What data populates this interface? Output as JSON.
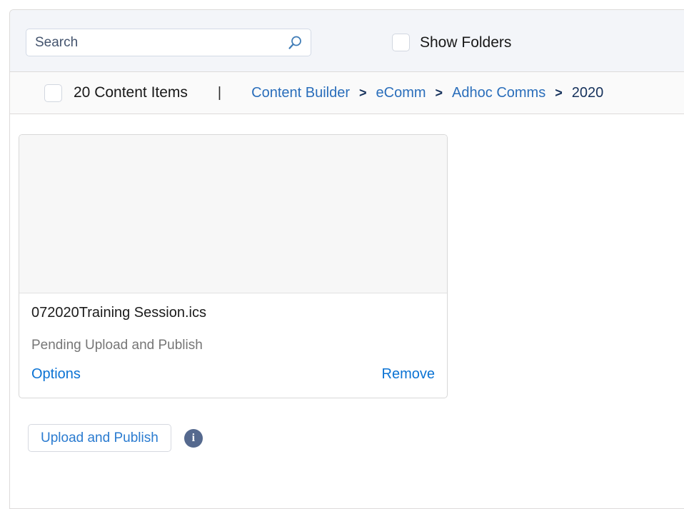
{
  "search": {
    "placeholder": "Search",
    "value": "",
    "icon": "search-icon"
  },
  "show_folders": {
    "label": "Show Folders",
    "checked": false
  },
  "toolbar": {
    "select_all_checked": false,
    "count_label": "20 Content Items",
    "divider": "|"
  },
  "breadcrumb": {
    "separator": ">",
    "items": [
      {
        "label": "Content Builder",
        "current": false
      },
      {
        "label": "eComm",
        "current": false
      },
      {
        "label": "Adhoc Comms",
        "current": false
      },
      {
        "label": "2020",
        "current": true
      }
    ]
  },
  "assets": [
    {
      "title": "072020Training Session.ics",
      "status": "Pending Upload and Publish",
      "options_label": "Options",
      "remove_label": "Remove"
    }
  ],
  "footer": {
    "publish_label": "Upload and Publish",
    "info_glyph": "i"
  },
  "colors": {
    "link_blue": "#0b73d4",
    "crumb_blue": "#2a6ebb",
    "crumb_current": "#16325c",
    "header_bg": "#f3f5f9",
    "crumb_bg": "#fafafa",
    "info_badge": "#55698e"
  }
}
